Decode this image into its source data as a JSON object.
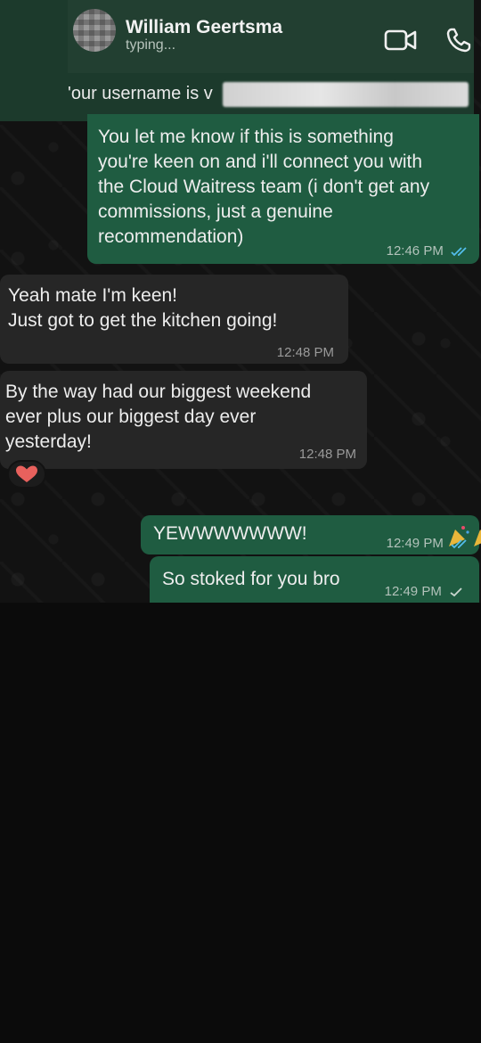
{
  "header": {
    "contact_name": "William Geertsma",
    "status": "typing...",
    "video_icon": "video-camera-icon",
    "call_icon": "phone-icon"
  },
  "notice": {
    "text": "'our username is v"
  },
  "messages": [
    {
      "direction": "outgoing",
      "text": "You let me know if this is something\nyou're keen on and i'll connect you with\nthe Cloud Waitress team (i don't get any\ncommissions, just a genuine\nrecommendation)",
      "time": "12:46 PM",
      "status": "read"
    },
    {
      "direction": "incoming",
      "text": "Yeah mate I'm keen!\nJust got to get the kitchen going!",
      "time": "12:48 PM"
    },
    {
      "direction": "incoming",
      "text": "By the way had our biggest weekend\never plus our biggest day ever\nyesterday!",
      "time": "12:48 PM",
      "reaction": "heart"
    },
    {
      "direction": "outgoing",
      "text": "YEWWWWWWW!",
      "emoji": "🎉🎉",
      "time": "12:49 PM",
      "status": "read"
    },
    {
      "direction": "outgoing",
      "text": "So stoked for you bro",
      "time": "12:49 PM",
      "status": "sent"
    }
  ],
  "colors": {
    "outgoing_bubble": "#1f5c41",
    "incoming_bubble": "#262626",
    "header": "#223f31",
    "read_tick": "#53bdeb",
    "heart": "#e8615d"
  }
}
